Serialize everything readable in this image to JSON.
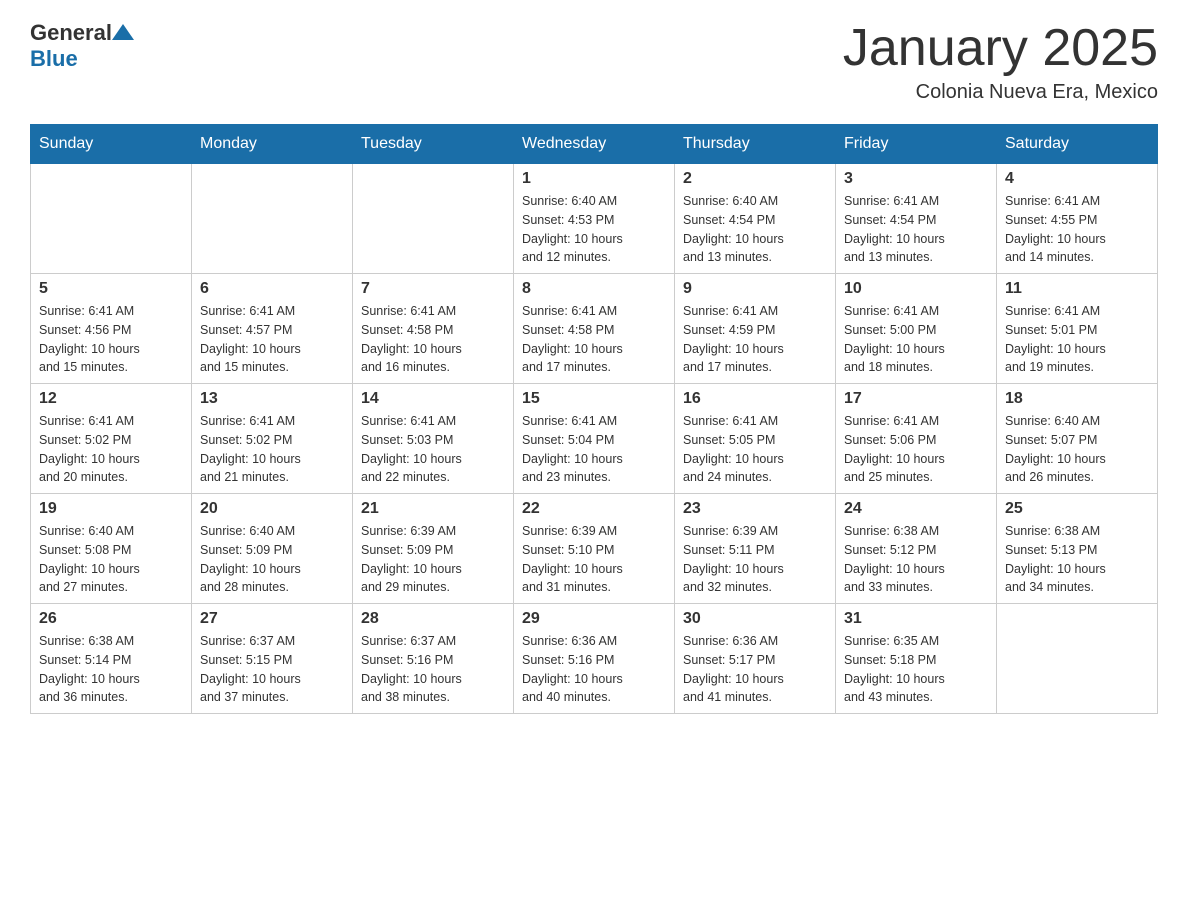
{
  "header": {
    "logo": {
      "general": "General",
      "blue": "Blue"
    },
    "title": "January 2025",
    "location": "Colonia Nueva Era, Mexico"
  },
  "calendar": {
    "days_of_week": [
      "Sunday",
      "Monday",
      "Tuesday",
      "Wednesday",
      "Thursday",
      "Friday",
      "Saturday"
    ],
    "weeks": [
      [
        {
          "day": "",
          "info": ""
        },
        {
          "day": "",
          "info": ""
        },
        {
          "day": "",
          "info": ""
        },
        {
          "day": "1",
          "info": "Sunrise: 6:40 AM\nSunset: 4:53 PM\nDaylight: 10 hours\nand 12 minutes."
        },
        {
          "day": "2",
          "info": "Sunrise: 6:40 AM\nSunset: 4:54 PM\nDaylight: 10 hours\nand 13 minutes."
        },
        {
          "day": "3",
          "info": "Sunrise: 6:41 AM\nSunset: 4:54 PM\nDaylight: 10 hours\nand 13 minutes."
        },
        {
          "day": "4",
          "info": "Sunrise: 6:41 AM\nSunset: 4:55 PM\nDaylight: 10 hours\nand 14 minutes."
        }
      ],
      [
        {
          "day": "5",
          "info": "Sunrise: 6:41 AM\nSunset: 4:56 PM\nDaylight: 10 hours\nand 15 minutes."
        },
        {
          "day": "6",
          "info": "Sunrise: 6:41 AM\nSunset: 4:57 PM\nDaylight: 10 hours\nand 15 minutes."
        },
        {
          "day": "7",
          "info": "Sunrise: 6:41 AM\nSunset: 4:58 PM\nDaylight: 10 hours\nand 16 minutes."
        },
        {
          "day": "8",
          "info": "Sunrise: 6:41 AM\nSunset: 4:58 PM\nDaylight: 10 hours\nand 17 minutes."
        },
        {
          "day": "9",
          "info": "Sunrise: 6:41 AM\nSunset: 4:59 PM\nDaylight: 10 hours\nand 17 minutes."
        },
        {
          "day": "10",
          "info": "Sunrise: 6:41 AM\nSunset: 5:00 PM\nDaylight: 10 hours\nand 18 minutes."
        },
        {
          "day": "11",
          "info": "Sunrise: 6:41 AM\nSunset: 5:01 PM\nDaylight: 10 hours\nand 19 minutes."
        }
      ],
      [
        {
          "day": "12",
          "info": "Sunrise: 6:41 AM\nSunset: 5:02 PM\nDaylight: 10 hours\nand 20 minutes."
        },
        {
          "day": "13",
          "info": "Sunrise: 6:41 AM\nSunset: 5:02 PM\nDaylight: 10 hours\nand 21 minutes."
        },
        {
          "day": "14",
          "info": "Sunrise: 6:41 AM\nSunset: 5:03 PM\nDaylight: 10 hours\nand 22 minutes."
        },
        {
          "day": "15",
          "info": "Sunrise: 6:41 AM\nSunset: 5:04 PM\nDaylight: 10 hours\nand 23 minutes."
        },
        {
          "day": "16",
          "info": "Sunrise: 6:41 AM\nSunset: 5:05 PM\nDaylight: 10 hours\nand 24 minutes."
        },
        {
          "day": "17",
          "info": "Sunrise: 6:41 AM\nSunset: 5:06 PM\nDaylight: 10 hours\nand 25 minutes."
        },
        {
          "day": "18",
          "info": "Sunrise: 6:40 AM\nSunset: 5:07 PM\nDaylight: 10 hours\nand 26 minutes."
        }
      ],
      [
        {
          "day": "19",
          "info": "Sunrise: 6:40 AM\nSunset: 5:08 PM\nDaylight: 10 hours\nand 27 minutes."
        },
        {
          "day": "20",
          "info": "Sunrise: 6:40 AM\nSunset: 5:09 PM\nDaylight: 10 hours\nand 28 minutes."
        },
        {
          "day": "21",
          "info": "Sunrise: 6:39 AM\nSunset: 5:09 PM\nDaylight: 10 hours\nand 29 minutes."
        },
        {
          "day": "22",
          "info": "Sunrise: 6:39 AM\nSunset: 5:10 PM\nDaylight: 10 hours\nand 31 minutes."
        },
        {
          "day": "23",
          "info": "Sunrise: 6:39 AM\nSunset: 5:11 PM\nDaylight: 10 hours\nand 32 minutes."
        },
        {
          "day": "24",
          "info": "Sunrise: 6:38 AM\nSunset: 5:12 PM\nDaylight: 10 hours\nand 33 minutes."
        },
        {
          "day": "25",
          "info": "Sunrise: 6:38 AM\nSunset: 5:13 PM\nDaylight: 10 hours\nand 34 minutes."
        }
      ],
      [
        {
          "day": "26",
          "info": "Sunrise: 6:38 AM\nSunset: 5:14 PM\nDaylight: 10 hours\nand 36 minutes."
        },
        {
          "day": "27",
          "info": "Sunrise: 6:37 AM\nSunset: 5:15 PM\nDaylight: 10 hours\nand 37 minutes."
        },
        {
          "day": "28",
          "info": "Sunrise: 6:37 AM\nSunset: 5:16 PM\nDaylight: 10 hours\nand 38 minutes."
        },
        {
          "day": "29",
          "info": "Sunrise: 6:36 AM\nSunset: 5:16 PM\nDaylight: 10 hours\nand 40 minutes."
        },
        {
          "day": "30",
          "info": "Sunrise: 6:36 AM\nSunset: 5:17 PM\nDaylight: 10 hours\nand 41 minutes."
        },
        {
          "day": "31",
          "info": "Sunrise: 6:35 AM\nSunset: 5:18 PM\nDaylight: 10 hours\nand 43 minutes."
        },
        {
          "day": "",
          "info": ""
        }
      ]
    ]
  }
}
